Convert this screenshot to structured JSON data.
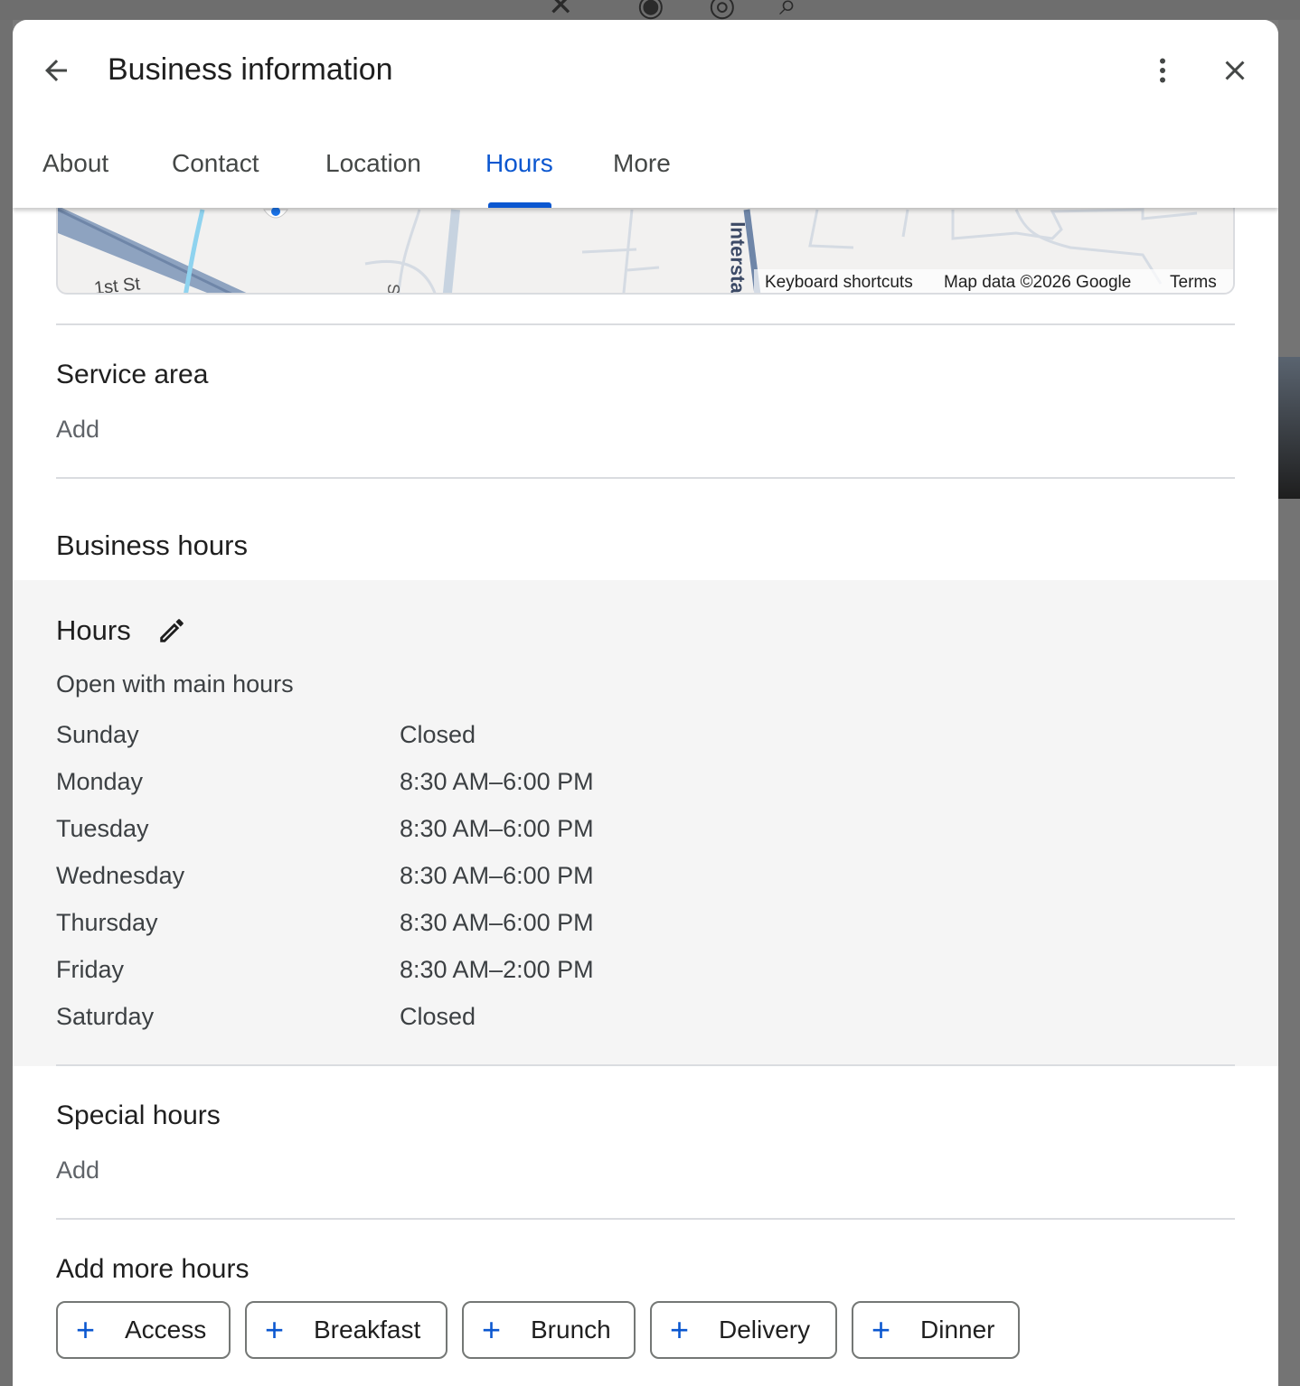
{
  "header": {
    "title": "Business information"
  },
  "tabs": [
    {
      "label": "About",
      "active": false
    },
    {
      "label": "Contact",
      "active": false
    },
    {
      "label": "Location",
      "active": false
    },
    {
      "label": "Hours",
      "active": true
    },
    {
      "label": "More",
      "active": false
    }
  ],
  "map": {
    "street_label_1": "1st St",
    "street_label_2": "St",
    "highway_label": "Intersta",
    "keyboard_shortcuts": "Keyboard shortcuts",
    "map_data": "Map data ©2026 Google",
    "terms": "Terms"
  },
  "service_area": {
    "title": "Service area",
    "add_label": "Add"
  },
  "business_hours": {
    "title": "Business hours",
    "hours_label": "Hours",
    "subtitle": "Open with main hours",
    "days": [
      {
        "day": "Sunday",
        "hours": "Closed"
      },
      {
        "day": "Monday",
        "hours": "8:30 AM–6:00 PM"
      },
      {
        "day": "Tuesday",
        "hours": "8:30 AM–6:00 PM"
      },
      {
        "day": "Wednesday",
        "hours": "8:30 AM–6:00 PM"
      },
      {
        "day": "Thursday",
        "hours": "8:30 AM–6:00 PM"
      },
      {
        "day": "Friday",
        "hours": "8:30 AM–2:00 PM"
      },
      {
        "day": "Saturday",
        "hours": "Closed"
      }
    ]
  },
  "special_hours": {
    "title": "Special hours",
    "add_label": "Add"
  },
  "add_more_hours": {
    "title": "Add more hours",
    "chips": [
      "Access",
      "Breakfast",
      "Brunch",
      "Delivery",
      "Dinner"
    ]
  },
  "colors": {
    "accent": "#0b57d0",
    "hours_background": "#f5f5f5"
  },
  "icons": {
    "back": "arrow-back-icon",
    "more": "more-vert-icon",
    "close": "close-icon",
    "edit": "pencil-icon",
    "add": "plus-icon"
  }
}
